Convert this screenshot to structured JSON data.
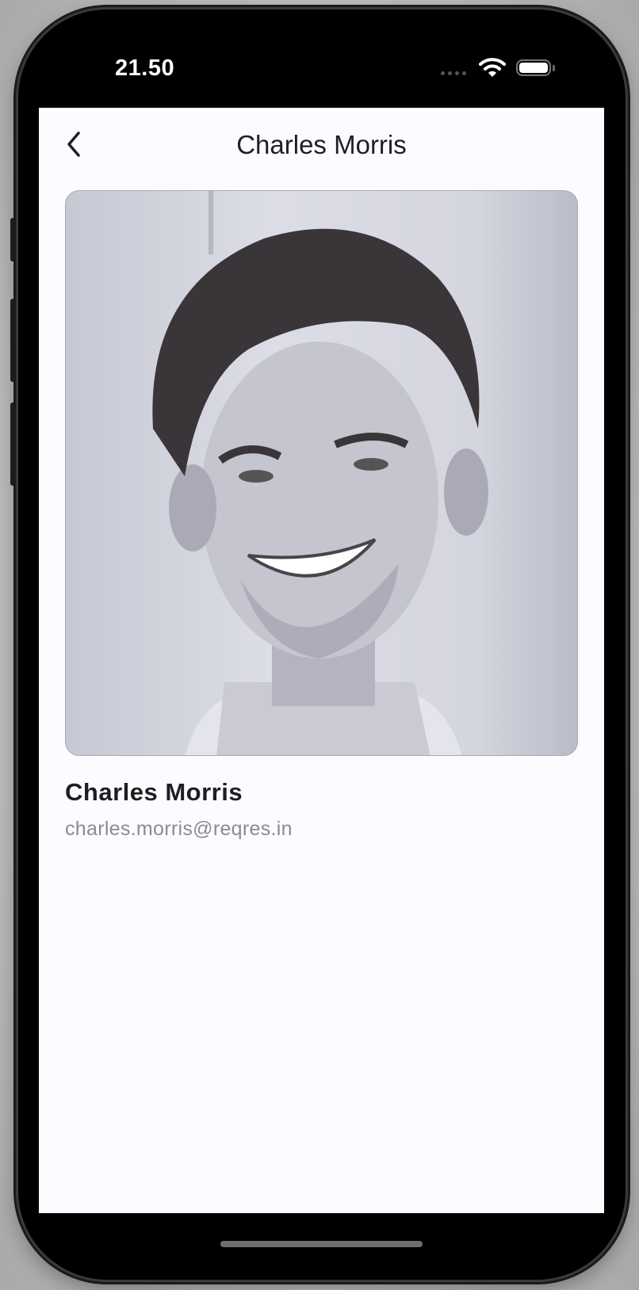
{
  "status_bar": {
    "time": "21.50"
  },
  "header": {
    "title": "Charles Morris",
    "back_icon": "chevron-left-icon"
  },
  "profile": {
    "name": "Charles Morris",
    "email": "charles.morris@reqres.in"
  },
  "colors": {
    "screen_bg": "#fdfbff",
    "text_primary": "#1e1e21",
    "text_secondary": "#8b8b90"
  }
}
